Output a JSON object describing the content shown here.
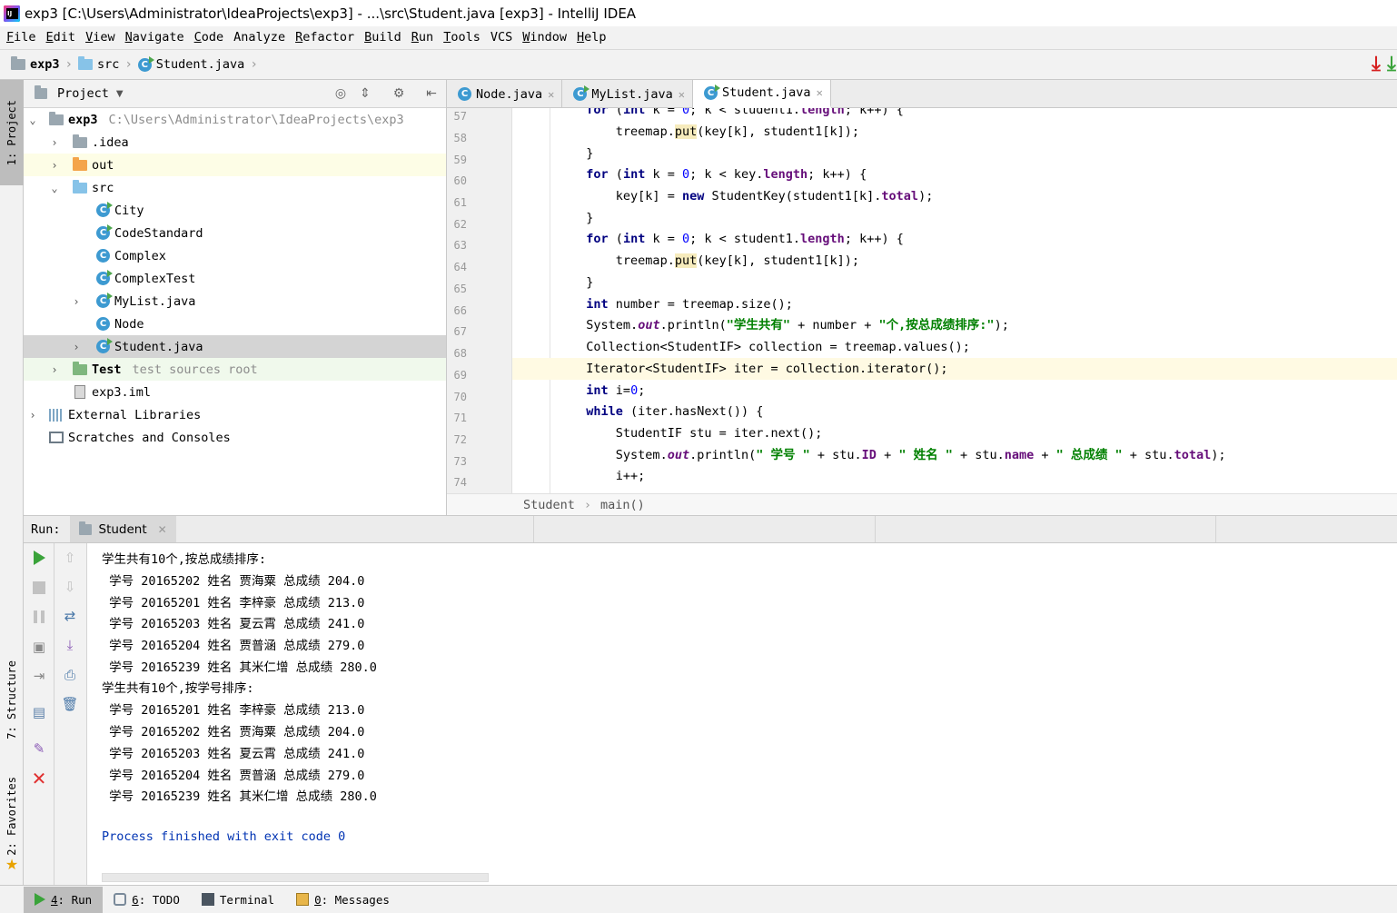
{
  "window": {
    "title": "exp3 [C:\\Users\\Administrator\\IdeaProjects\\exp3] - ...\\src\\Student.java [exp3] - IntelliJ IDEA"
  },
  "menu": [
    {
      "acc": "F",
      "rest": "ile"
    },
    {
      "acc": "E",
      "rest": "dit"
    },
    {
      "acc": "V",
      "rest": "iew"
    },
    {
      "acc": "N",
      "rest": "avigate"
    },
    {
      "acc": "C",
      "rest": "ode"
    },
    {
      "acc": "",
      "rest": "Analyze"
    },
    {
      "acc": "R",
      "rest": "efactor"
    },
    {
      "acc": "B",
      "rest": "uild"
    },
    {
      "acc": "R",
      "rest": "un"
    },
    {
      "acc": "T",
      "rest": "ools"
    },
    {
      "acc": "",
      "rest": "VCS"
    },
    {
      "acc": "W",
      "rest": "indow"
    },
    {
      "acc": "H",
      "rest": "elp"
    }
  ],
  "breadcrumb": {
    "project": "exp3",
    "folder": "src",
    "file": "Student.java"
  },
  "left_strip": {
    "project": "1: Project",
    "structure": "7: Structure",
    "favorites": "2: Favorites"
  },
  "project_panel": {
    "title": "Project",
    "root": {
      "name": "exp3",
      "path": "C:\\Users\\Administrator\\IdeaProjects\\exp3"
    },
    "idea": ".idea",
    "out": "out",
    "src": "src",
    "classes": [
      "City",
      "CodeStandard",
      "Complex",
      "ComplexTest",
      "MyList.java",
      "Node",
      "Student.java"
    ],
    "test": {
      "name": "Test",
      "hint": "test sources root"
    },
    "iml": "exp3.iml",
    "external": "External Libraries",
    "scratches": "Scratches and Consoles"
  },
  "editor": {
    "tabs": [
      "Node.java",
      "MyList.java",
      "Student.java"
    ],
    "active_tab": "Student.java",
    "line_numbers": [
      "57",
      "58",
      "59",
      "60",
      "61",
      "62",
      "63",
      "64",
      "65",
      "66",
      "67",
      "68",
      "69",
      "70",
      "71",
      "72",
      "73",
      "74"
    ],
    "breadcrumb_class": "Student",
    "breadcrumb_method": "main()"
  },
  "run": {
    "label": "Run:",
    "tab": "Student",
    "output": [
      "学生共有10个,按总成绩排序:",
      " 学号 20165202 姓名 贾海粟 总成绩 204.0",
      " 学号 20165201 姓名 李梓豪 总成绩 213.0",
      " 学号 20165203 姓名 夏云霄 总成绩 241.0",
      " 学号 20165204 姓名 贾普涵 总成绩 279.0",
      " 学号 20165239 姓名 其米仁增 总成绩 280.0",
      "学生共有10个,按学号排序:",
      " 学号 20165201 姓名 李梓豪 总成绩 213.0",
      " 学号 20165202 姓名 贾海粟 总成绩 204.0",
      " 学号 20165203 姓名 夏云霄 总成绩 241.0",
      " 学号 20165204 姓名 贾普涵 总成绩 279.0",
      " 学号 20165239 姓名 其米仁增 总成绩 280.0",
      "",
      "Process finished with exit code 0"
    ]
  },
  "bottom_tabs": [
    {
      "key": "4",
      "label": ": Run"
    },
    {
      "key": "6",
      "label": ": TODO"
    },
    {
      "key": "",
      "label": "Terminal"
    },
    {
      "key": "0",
      "label": ": Messages"
    }
  ]
}
